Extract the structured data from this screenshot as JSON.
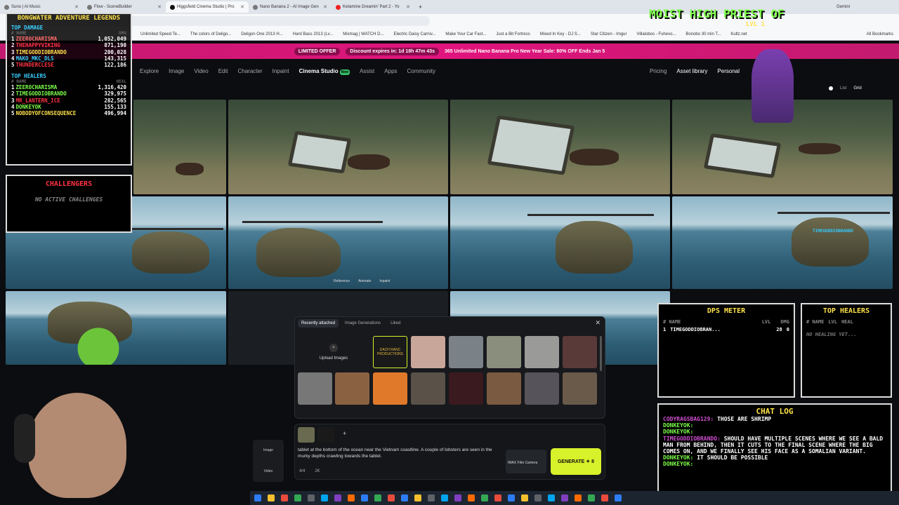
{
  "browser": {
    "tabs": [
      {
        "label": "Suno | AI Music",
        "active": false
      },
      {
        "label": "Flow - SceneBuilder",
        "active": false
      },
      {
        "label": "Higgsfield Cinema Studio | Pro",
        "active": true
      },
      {
        "label": "Nano Banana 2 - AI Image Gen",
        "active": false
      },
      {
        "label": "Ketamine Dreamin' Part 2 - Yo",
        "active": false
      }
    ],
    "gemini_label": "Gemini",
    "bookmarks": [
      "Unlimited Speed Te...",
      "The colors of Deligo...",
      "Deligon One 2013 H...",
      "Hard Bass 2013 (Lv...",
      "Mixmag | WATCH D...",
      "Electric Daisy Carniv...",
      "Make Your Car Fast...",
      "Just a Bit Fortress",
      "Mixed In Key - DJ S...",
      "Star Citizen - Imgur",
      "Villalobos - Fuhevo...",
      "Bonobo 30 min T...",
      "Kultz.net"
    ],
    "all_bookmarks": "All Bookmarks"
  },
  "promo": {
    "pill": "LIMITED OFFER",
    "discount": "Discount expires in: 1d 18h 47m 43s",
    "message": "365 Unlimited Nano Banana Pro New Year Sale: 80% OFF Ends Jan 5"
  },
  "nav": {
    "items": [
      "Explore",
      "Image",
      "Video",
      "Edit",
      "Character",
      "Inpaint",
      "Cinema Studio",
      "Assist",
      "Apps",
      "Community"
    ],
    "new_badge": "New",
    "right": [
      "Pricing",
      "Asset library",
      "Personal"
    ]
  },
  "view_toggle": {
    "list": "List",
    "grid": "Grid"
  },
  "hover_actions": [
    "Reference",
    "Animate",
    "Inpaint"
  ],
  "modal": {
    "tabs": [
      "Recently attached",
      "Image Generations",
      "Liked"
    ],
    "upload_label": "Upload Images",
    "badge_text": "DACH RANC PRODUCTIONS"
  },
  "prompt": {
    "text": "tablet at the bottom of the ocean near the Vietnam coastline. A couple of lobsters are seen in the murky depths crawling towards the tablet.",
    "side_image": "Image",
    "side_video": "Video",
    "count": "4/4",
    "likes": "2K",
    "camera": "IMAX Film Camera",
    "generate": "GENERATE",
    "cost": "8"
  },
  "overlay_legends": {
    "title": "BONGWATER ADVENTURE LEGENDS",
    "damage_header": "TOP DAMAGE",
    "col_name": "# NAME",
    "col_dmg": "DMG",
    "damage_rows": [
      {
        "rank": "1",
        "name": "ZEEROCHARISMA",
        "value": "1,052,049"
      },
      {
        "rank": "2",
        "name": "THEHAPPYVIKING",
        "value": "871,190"
      },
      {
        "rank": "3",
        "name": "TIMEGODDIOBRANDO",
        "value": "200,028"
      },
      {
        "rank": "4",
        "name": "MAKO_MKC_DLS",
        "value": "143,315"
      },
      {
        "rank": "5",
        "name": "THUNDERCLESE",
        "value": "122,186"
      }
    ],
    "healer_header": "TOP HEALERS",
    "col_heal": "HEAL",
    "healer_rows": [
      {
        "rank": "1",
        "name": "ZEEROCHARISMA",
        "value": "1,316,420"
      },
      {
        "rank": "2",
        "name": "TIMEGODDIOBRANDO",
        "value": "329,975"
      },
      {
        "rank": "3",
        "name": "MR_LANTERN_ICE",
        "value": "282,565"
      },
      {
        "rank": "4",
        "name": "DONKEYOK",
        "value": "155,133"
      },
      {
        "rank": "5",
        "name": "NOBODYOFCONSEQUENCE",
        "value": "496,994"
      }
    ]
  },
  "challengers": {
    "title": "CHALLENGERS",
    "empty": "NO ACTIVE CHALLENGES"
  },
  "priest": {
    "title": "MOIST HIGH PRIEST OF",
    "level": "LVL 1"
  },
  "dps": {
    "title": "DPS METER",
    "cols": [
      "# NAME",
      "LVL",
      "DMG"
    ],
    "row": {
      "rank": "1",
      "name": "TIMEGODDIOBRAN...",
      "lvl": "28",
      "dmg": "0"
    }
  },
  "healers_small": {
    "title": "TOP HEALERS",
    "cols": [
      "# NAME",
      "LVL",
      "HEAL"
    ],
    "empty": "NO HEALING YET..."
  },
  "chat": {
    "title": "CHAT LOG",
    "lines": [
      {
        "user": "CODYRAGSBAG129:",
        "text": "THOSE ARE SHRIMP",
        "color": "#d04ed0"
      },
      {
        "user": "DONKEYOK:",
        "text": "",
        "color": "#7dff4a"
      },
      {
        "user": "DONKEYOK:",
        "text": "",
        "color": "#7dff4a"
      },
      {
        "user": "TIMEGODDIOBRANDO:",
        "text": "SHOULD HAVE MULTIPLE SCENES WHERE WE SEE A BALD MAN FROM BEHIND, THEN IT CUTS TO THE FINAL SCENE WHERE THE BIG COMES ON, AND WE FINALLY SEE HIS FACE AS A SOMALIAN VARIANT.",
        "color": "#d04ed0"
      },
      {
        "user": "DONKEYOK:",
        "text": "IT SHOULD BE POSSIBLE",
        "color": "#7dff4a"
      },
      {
        "user": "DONKEYOK:",
        "text": "",
        "color": "#7dff4a"
      }
    ]
  },
  "heli_tag": "TIMEGODDIOBRANDO",
  "colors": {
    "promo": "#e0147c",
    "generate": "#d7f12a",
    "overlay_green": "#7dff4a",
    "overlay_red": "#ff3344",
    "overlay_cyan": "#39d0ff"
  }
}
